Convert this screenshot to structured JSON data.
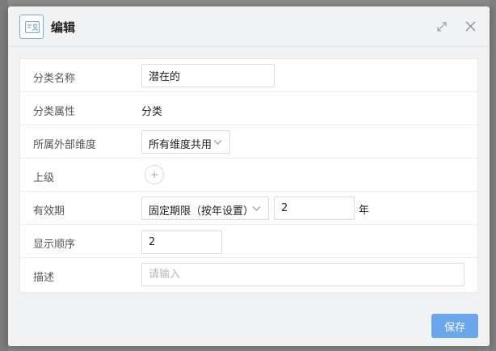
{
  "dialog": {
    "title": "编辑",
    "icons": {
      "header": "edit-card-icon",
      "expand": "expand-icon",
      "close": "close-icon"
    }
  },
  "form": {
    "category_name": {
      "label": "分类名称",
      "value": "潜在的"
    },
    "category_attribute": {
      "label": "分类属性",
      "value": "分类"
    },
    "external_dimension": {
      "label": "所属外部维度",
      "selected": "所有维度共用"
    },
    "parent": {
      "label": "上级",
      "icon": "plus-icon"
    },
    "validity": {
      "label": "有效期",
      "selected": "固定期限（按年设置）",
      "value": "2",
      "unit": "年"
    },
    "display_order": {
      "label": "显示顺序",
      "value": "2"
    },
    "description": {
      "label": "描述",
      "placeholder": "请输入",
      "value": ""
    }
  },
  "footer": {
    "save_label": "保存"
  },
  "colors": {
    "accent": "#6aa6ec",
    "icon_border": "#7aa7e6"
  }
}
